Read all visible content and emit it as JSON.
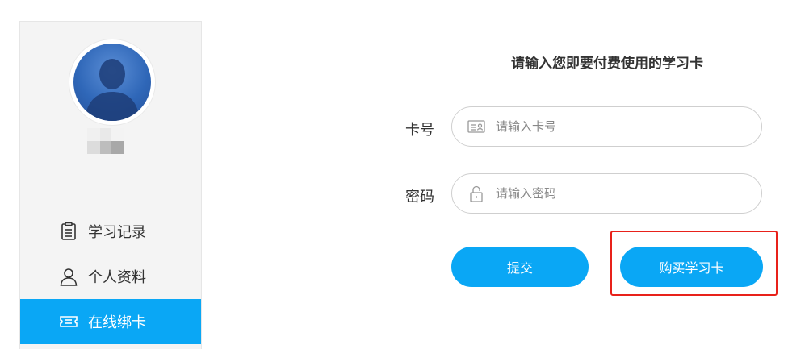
{
  "sidebar": {
    "items": [
      {
        "label": "学习记录",
        "icon": "clipboard-icon"
      },
      {
        "label": "个人资料",
        "icon": "user-icon"
      },
      {
        "label": "在线绑卡",
        "icon": "ticket-icon",
        "active": true
      }
    ]
  },
  "form": {
    "title": "请输入您即要付费使用的学习卡",
    "card_number": {
      "label": "卡号",
      "placeholder": "请输入卡号",
      "value": "",
      "icon": "id-card-icon"
    },
    "password": {
      "label": "密码",
      "placeholder": "请输入密码",
      "value": "",
      "icon": "lock-icon"
    },
    "submit_label": "提交",
    "buy_label": "购买学习卡"
  },
  "colors": {
    "accent": "#0aa7f5",
    "sidebar_bg": "#f4f4f4",
    "highlight": "#e8211a"
  }
}
